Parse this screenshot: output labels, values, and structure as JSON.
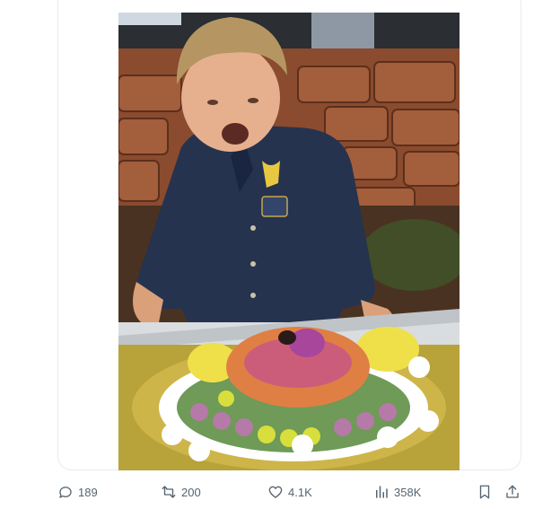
{
  "post": {
    "media": {
      "kind": "photo",
      "icon": "photo-image"
    },
    "actions": {
      "reply": {
        "icon": "reply-icon",
        "count": "189"
      },
      "repost": {
        "icon": "repost-icon",
        "count": "200"
      },
      "like": {
        "icon": "heart-icon",
        "count": "4.1K"
      },
      "views": {
        "icon": "views-icon",
        "count": "358K"
      },
      "bookmark": {
        "icon": "bookmark-icon"
      },
      "share": {
        "icon": "share-icon"
      }
    }
  },
  "colors": {
    "border": "#e6ecf0",
    "action_text": "#536471",
    "background": "#ffffff"
  }
}
